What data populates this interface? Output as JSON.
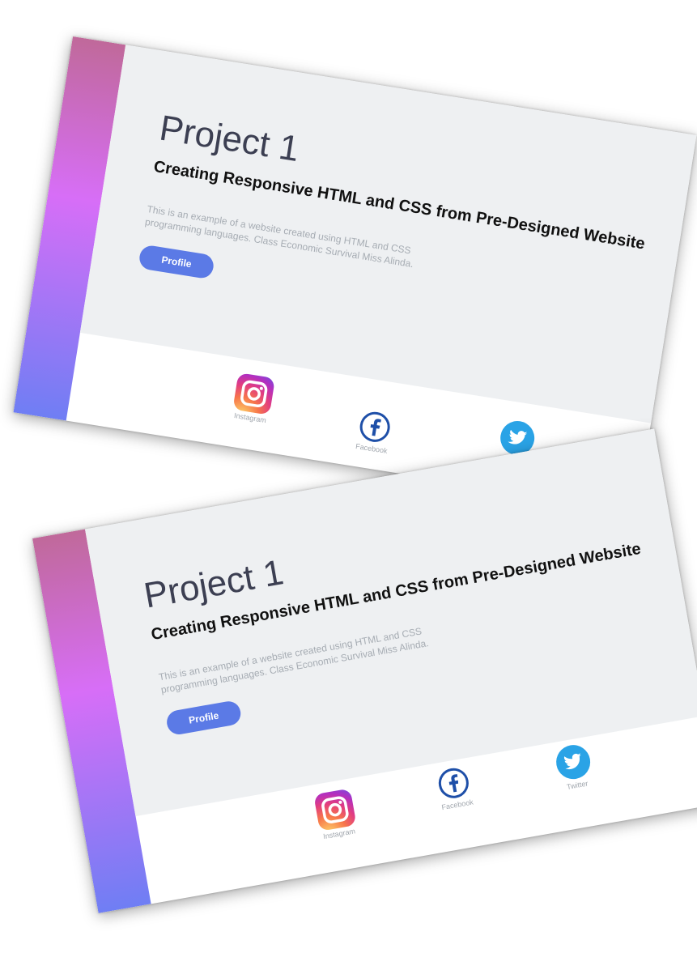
{
  "cards": [
    {
      "title": "Project 1",
      "subtitle": "Creating Responsive HTML and CSS from Pre-Designed Website",
      "description": "This is an example of a website created using HTML and CSS programming languages. Class Economic Survival Miss Alinda.",
      "profile_button": "Profile",
      "social": {
        "instagram": "Instagram",
        "facebook": "Facebook",
        "twitter": "Twitter"
      }
    },
    {
      "title": "Project 1",
      "subtitle": "Creating Responsive HTML and CSS from Pre-Designed Website",
      "description": "This is an example of a website created using HTML and CSS programming languages. Class Economic Survival Miss Alinda.",
      "profile_button": "Profile",
      "social": {
        "instagram": "Instagram",
        "facebook": "Facebook",
        "twitter": "Twitter"
      }
    }
  ],
  "icons": {
    "instagram": "instagram-icon",
    "facebook": "facebook-icon",
    "twitter": "twitter-icon"
  },
  "colors": {
    "sidebar_gradient": [
      "#c0699a",
      "#d76ef7",
      "#6f7ef4"
    ],
    "hero_background": "#eef0f2",
    "button": "#5b7ae6",
    "facebook": "#1e4fa8",
    "twitter": "#2aa3e6"
  }
}
